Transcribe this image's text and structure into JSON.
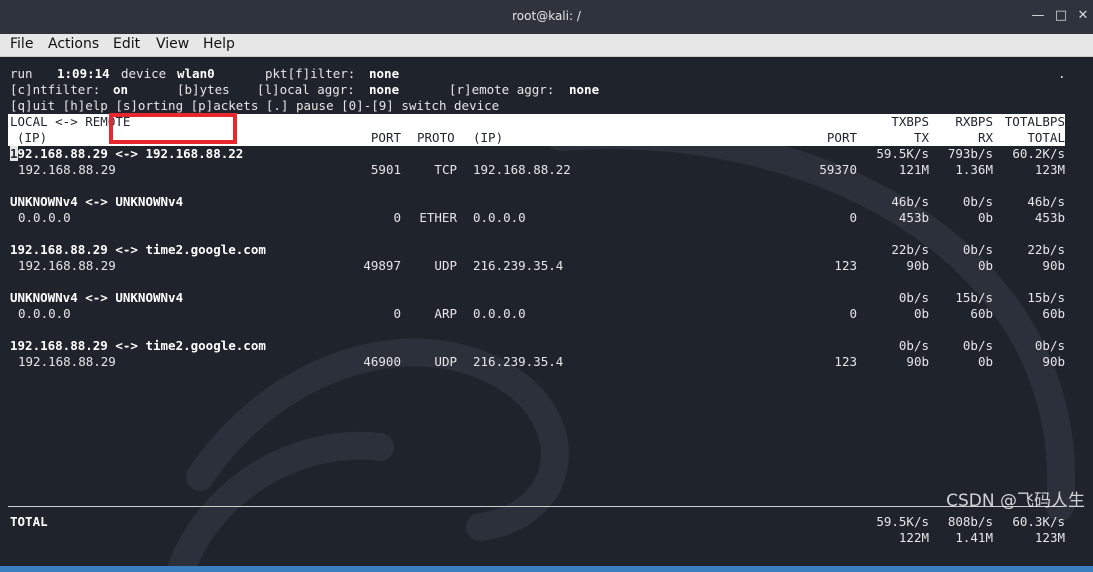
{
  "window": {
    "title": "root@kali: /"
  },
  "menu": [
    {
      "label": "File"
    },
    {
      "label": "Actions"
    },
    {
      "label": "Edit"
    },
    {
      "label": "View"
    },
    {
      "label": "Help"
    }
  ],
  "status": {
    "run_label": "run",
    "run_time": "1:09:14",
    "device_label": "device",
    "device_value": "wlan0",
    "pktfilter_label": "pkt[f]ilter:",
    "pktfilter_value": "none",
    "dot": ".",
    "cntfilter_label": "[c]ntfilter:",
    "cntfilter_value": "on",
    "bytes_label": "[b]ytes",
    "local_aggr_label": "[l]ocal aggr:",
    "local_aggr_value": "none",
    "remote_aggr_label": "[r]emote aggr:",
    "remote_aggr_value": "none",
    "help_line": "[q]uit [h]elp [s]orting [p]ackets [.] pause [0]-[9] switch device"
  },
  "header": {
    "local_remote": "LOCAL <-> REMOTE",
    "ip1": "(IP)",
    "port1": "PORT",
    "proto": "PROTO",
    "ip2": "(IP)",
    "port2": "PORT",
    "txbps": "TXBPS",
    "rxbps": "RXBPS",
    "totalbps": "TOTALBPS",
    "tx": "TX",
    "rx": "RX",
    "total": "TOTAL"
  },
  "flows": [
    {
      "title": "192.168.88.29 <-> 192.168.88.22",
      "cursor": "1",
      "title_rest": "92.168.88.29 <-> 192.168.88.22",
      "lip": "192.168.88.29",
      "lport": "5901",
      "proto": "TCP",
      "rip": "192.168.88.22",
      "rport": "59370",
      "txbps": "59.5K/s",
      "rxbps": "793b/s",
      "totbps": "60.2K/s",
      "tx": "121M",
      "rx": "1.36M",
      "tot": "123M"
    },
    {
      "title": "UNKNOWNv4 <-> UNKNOWNv4",
      "cursor": "",
      "title_rest": "UNKNOWNv4 <-> UNKNOWNv4",
      "lip": "0.0.0.0",
      "lport": "0",
      "proto": "ETHER",
      "rip": "0.0.0.0",
      "rport": "0",
      "txbps": "46b/s",
      "rxbps": "0b/s",
      "totbps": "46b/s",
      "tx": "453b",
      "rx": "0b",
      "tot": "453b"
    },
    {
      "title": "192.168.88.29 <-> time2.google.com",
      "cursor": "",
      "title_rest": "192.168.88.29 <-> time2.google.com",
      "lip": "192.168.88.29",
      "lport": "49897",
      "proto": "UDP",
      "rip": "216.239.35.4",
      "rport": "123",
      "txbps": "22b/s",
      "rxbps": "0b/s",
      "totbps": "22b/s",
      "tx": "90b",
      "rx": "0b",
      "tot": "90b"
    },
    {
      "title": "UNKNOWNv4 <-> UNKNOWNv4",
      "cursor": "",
      "title_rest": "UNKNOWNv4 <-> UNKNOWNv4",
      "lip": "0.0.0.0",
      "lport": "0",
      "proto": "ARP",
      "rip": "0.0.0.0",
      "rport": "0",
      "txbps": "0b/s",
      "rxbps": "15b/s",
      "totbps": "15b/s",
      "tx": "0b",
      "rx": "60b",
      "tot": "60b"
    },
    {
      "title": "192.168.88.29 <-> time2.google.com",
      "cursor": "",
      "title_rest": "192.168.88.29 <-> time2.google.com",
      "lip": "192.168.88.29",
      "lport": "46900",
      "proto": "UDP",
      "rip": "216.239.35.4",
      "rport": "123",
      "txbps": "0b/s",
      "rxbps": "0b/s",
      "totbps": "0b/s",
      "tx": "90b",
      "rx": "0b",
      "tot": "90b"
    }
  ],
  "total": {
    "label": "TOTAL",
    "txbps": "59.5K/s",
    "rxbps": "808b/s",
    "totbps": "60.3K/s",
    "tx": "122M",
    "rx": "1.41M",
    "tot": "123M"
  },
  "watermark": "CSDN @飞码人生",
  "colors": {
    "highlight_box": "#e8262d",
    "terminal_bg": "#1f232c"
  }
}
